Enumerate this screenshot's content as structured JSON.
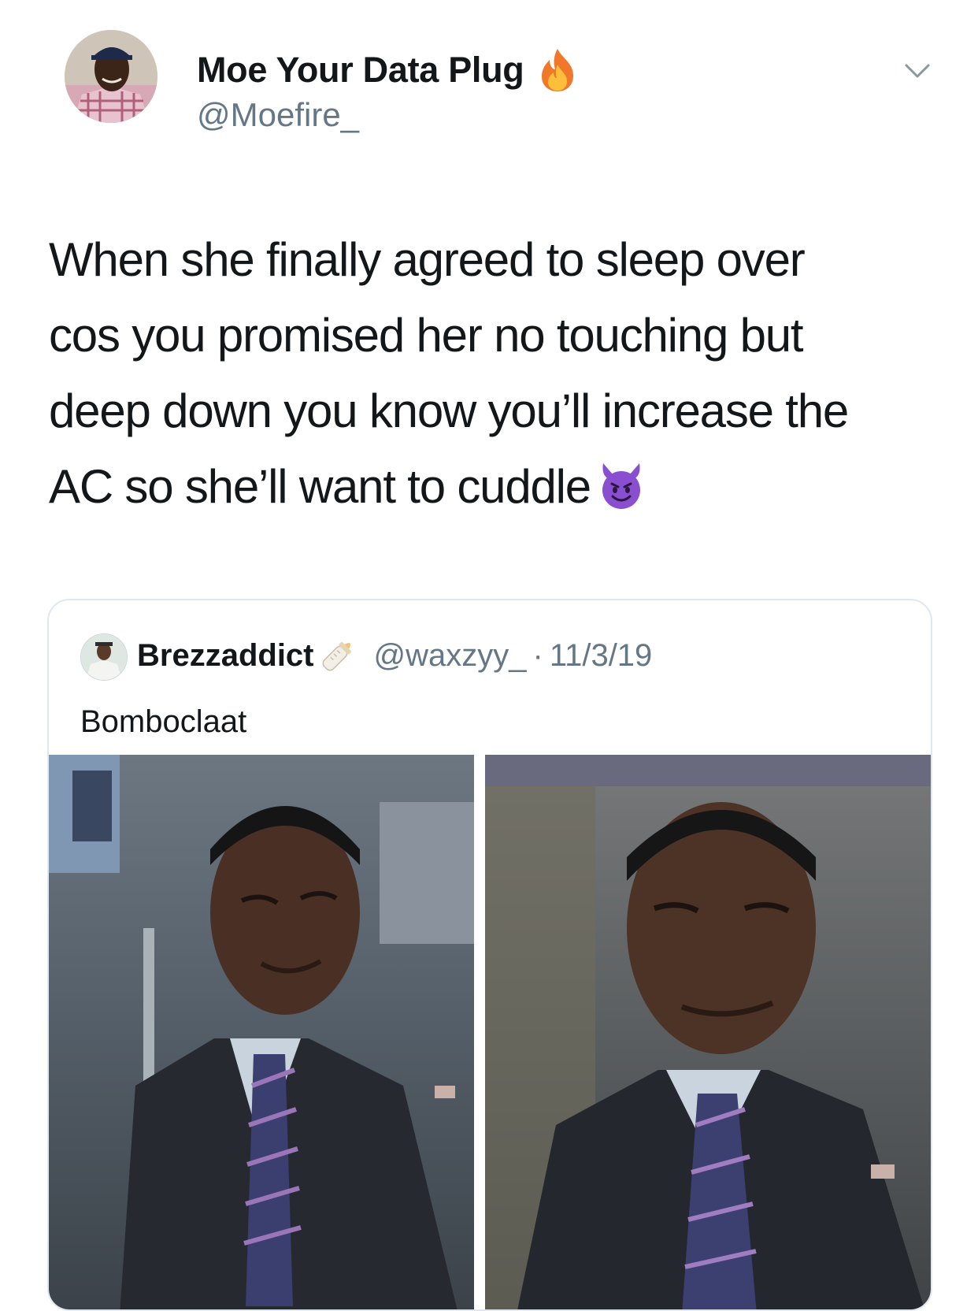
{
  "tweet": {
    "author": {
      "display_name": "Moe Your Data Plug",
      "handle": "@Moefire_",
      "name_emoji": "fire-icon"
    },
    "menu_icon": "chevron-down-icon",
    "text_lines": [
      "When she finally agreed to sleep over",
      "cos you promised her no touching but",
      "deep down you know you’ll increase the",
      "AC so she’ll want to cuddle"
    ],
    "text_emoji": "smiling-devil-icon"
  },
  "quoted_tweet": {
    "display_name": "Brezzaddict",
    "name_emoji": "baby-bottle-icon",
    "handle": "@waxzyy_",
    "separator": "·",
    "date": "11/3/19",
    "text": "Bomboclaat",
    "media_count": 2
  },
  "colors": {
    "text_primary": "#14171a",
    "text_secondary": "#657786",
    "border": "#e1e8ed",
    "background": "#ffffff"
  }
}
